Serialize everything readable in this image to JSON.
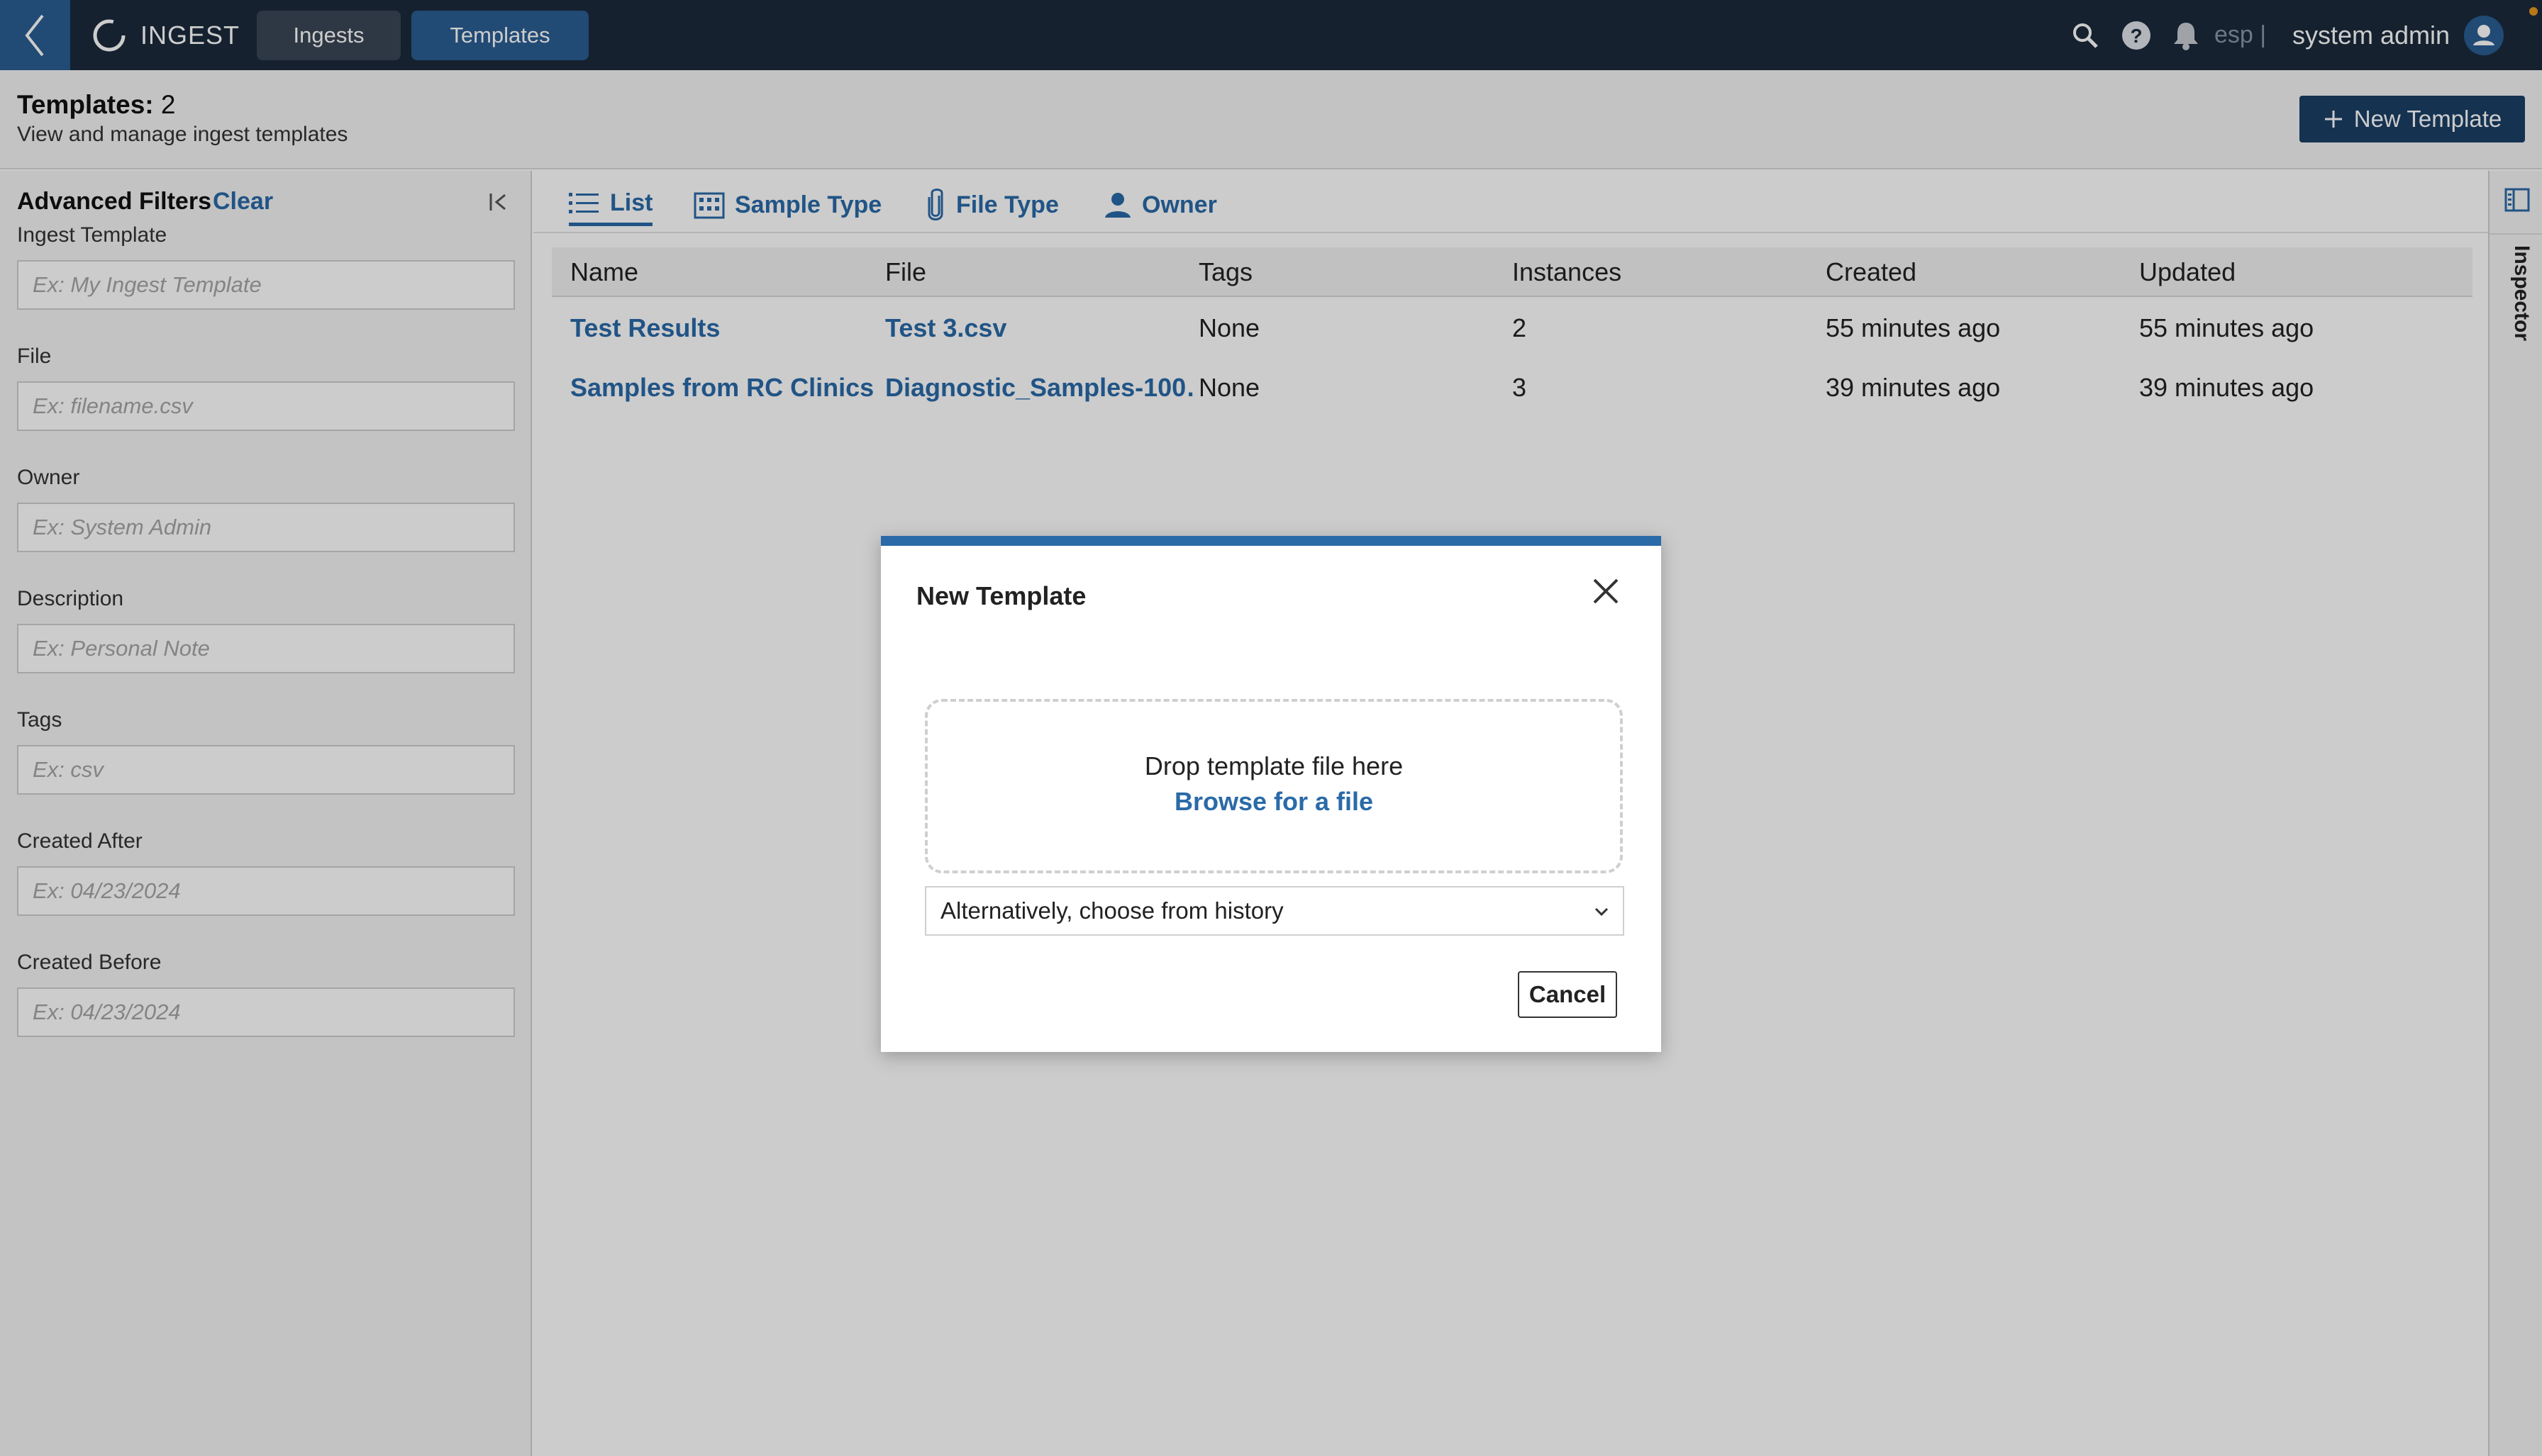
{
  "topbar": {
    "app_name": "INGEST",
    "tabs": [
      {
        "label": "Ingests",
        "active": false
      },
      {
        "label": "Templates",
        "active": true
      }
    ],
    "lab_code": "esp |",
    "user_name": "system admin",
    "icons": [
      "back-icon",
      "logo-icon",
      "search-icon",
      "help-icon",
      "bell-icon",
      "user-avatar-icon"
    ]
  },
  "header": {
    "title_label": "Templates:",
    "title_count": "2",
    "subtitle": "View and manage ingest templates",
    "new_button_label": "New Template"
  },
  "filters": {
    "title": "Advanced Filters",
    "clear_label": "Clear",
    "fields": [
      {
        "label": "Ingest Template",
        "placeholder": "Ex: My Ingest Template"
      },
      {
        "label": "File",
        "placeholder": "Ex: filename.csv"
      },
      {
        "label": "Owner",
        "placeholder": "Ex: System Admin"
      },
      {
        "label": "Description",
        "placeholder": "Ex: Personal Note"
      },
      {
        "label": "Tags",
        "placeholder": "Ex: csv"
      },
      {
        "label": "Created After",
        "placeholder": "Ex: 04/23/2024"
      },
      {
        "label": "Created Before",
        "placeholder": "Ex: 04/23/2024"
      }
    ]
  },
  "view_tabs": [
    {
      "label": "List",
      "icon": "list-icon",
      "active": true
    },
    {
      "label": "Sample Type",
      "icon": "building-icon",
      "active": false
    },
    {
      "label": "File Type",
      "icon": "paperclip-icon",
      "active": false
    },
    {
      "label": "Owner",
      "icon": "person-icon",
      "active": false
    }
  ],
  "table": {
    "columns": [
      "Name",
      "File",
      "Tags",
      "Instances",
      "Created",
      "Updated"
    ],
    "rows": [
      {
        "name": "Test Results",
        "file": "Test 3.csv",
        "tags": "None",
        "instances": "2",
        "created": "55 minutes ago",
        "updated": "55 minutes ago"
      },
      {
        "name": "Samples from RC Clinics",
        "file": "Diagnostic_Samples-100…",
        "tags": "None",
        "instances": "3",
        "created": "39 minutes ago",
        "updated": "39 minutes ago"
      }
    ]
  },
  "inspector": {
    "label": "Inspector"
  },
  "modal": {
    "title": "New Template",
    "drop_text": "Drop template file here",
    "browse_label": "Browse for a file",
    "history_selected": "Alternatively, choose from history",
    "cancel_label": "Cancel"
  },
  "colors": {
    "topbar_bg": "#1b2a3b",
    "accent": "#2a6aa8",
    "primary_button": "#1b3f66",
    "notification_dot": "#e8961e"
  }
}
